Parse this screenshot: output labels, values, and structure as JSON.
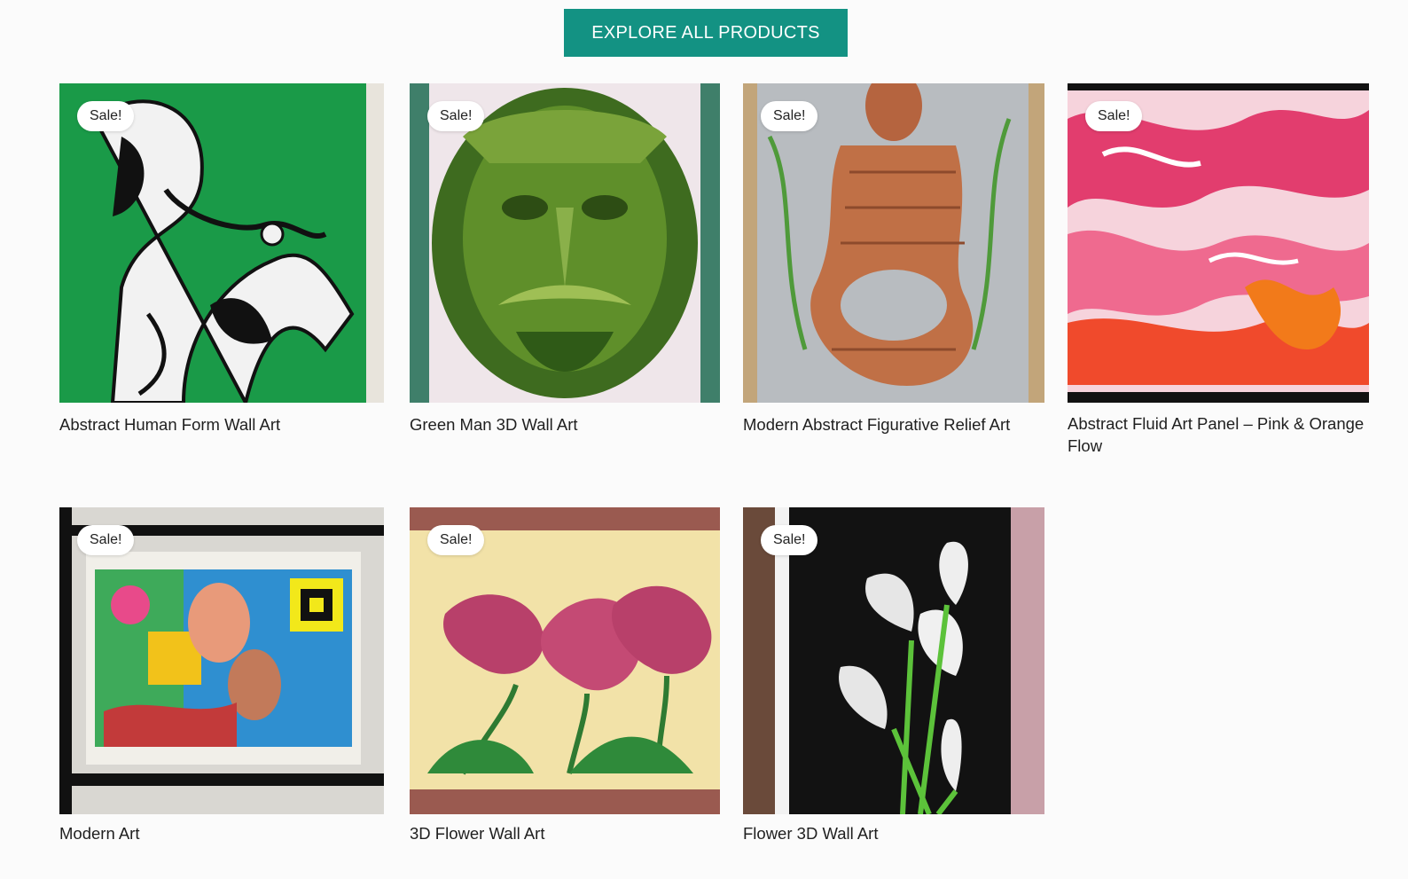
{
  "explore_button": {
    "label": "EXPLORE ALL PRODUCTS"
  },
  "products": [
    {
      "title": "Abstract Human Form Wall Art",
      "badge": "Sale!"
    },
    {
      "title": "Green Man 3D Wall Art",
      "badge": "Sale!"
    },
    {
      "title": "Modern Abstract Figurative Relief Art",
      "badge": "Sale!"
    },
    {
      "title": "Abstract Fluid Art Panel – Pink & Orange Flow",
      "badge": "Sale!"
    },
    {
      "title": "Modern Art",
      "badge": "Sale!"
    },
    {
      "title": "3D Flower Wall Art",
      "badge": "Sale!"
    },
    {
      "title": "Flower 3D Wall Art",
      "badge": "Sale!"
    }
  ],
  "colors": {
    "accent": "#139283",
    "background": "#fbfbfb"
  }
}
